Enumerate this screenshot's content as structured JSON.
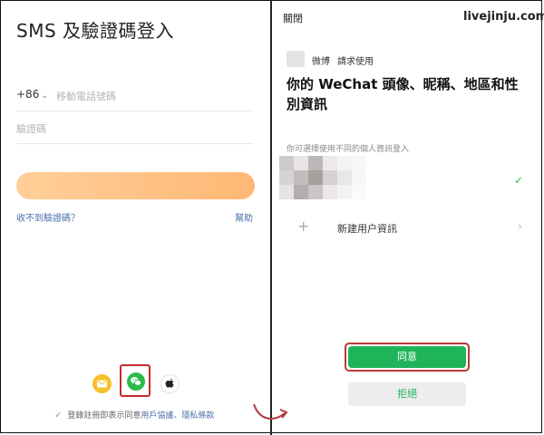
{
  "left": {
    "title": "SMS 及驗證碼登入",
    "country_code": "+86",
    "phone_placeholder": "移動電話號碼",
    "code_placeholder": "驗證碼",
    "link_no_code": "收不到驗證碼？",
    "link_help": "幫助",
    "social_icons": [
      "mail-icon",
      "wechat-icon",
      "apple-icon"
    ],
    "agreement_prefix": "登錄註冊即表示同意",
    "agreement_links": "用戶協議、隱私條款"
  },
  "right": {
    "close_label": "關閉",
    "watermark": "livejinju.com",
    "app_name": "微博",
    "app_request": "請求使用",
    "headline": "你的 WeChat 頭像、昵稱、地區和性別資訊",
    "subtitle": "你可選擇使用不同的個人資訊登入",
    "new_user_label": "新建用户資訊",
    "agree_label": "同意",
    "reject_label": "拒絕"
  },
  "colors": {
    "accent_orange": "#ffb774",
    "wechat_green": "#1fb35a",
    "link_blue": "#4a72a8",
    "highlight_red": "#c62a2a"
  }
}
